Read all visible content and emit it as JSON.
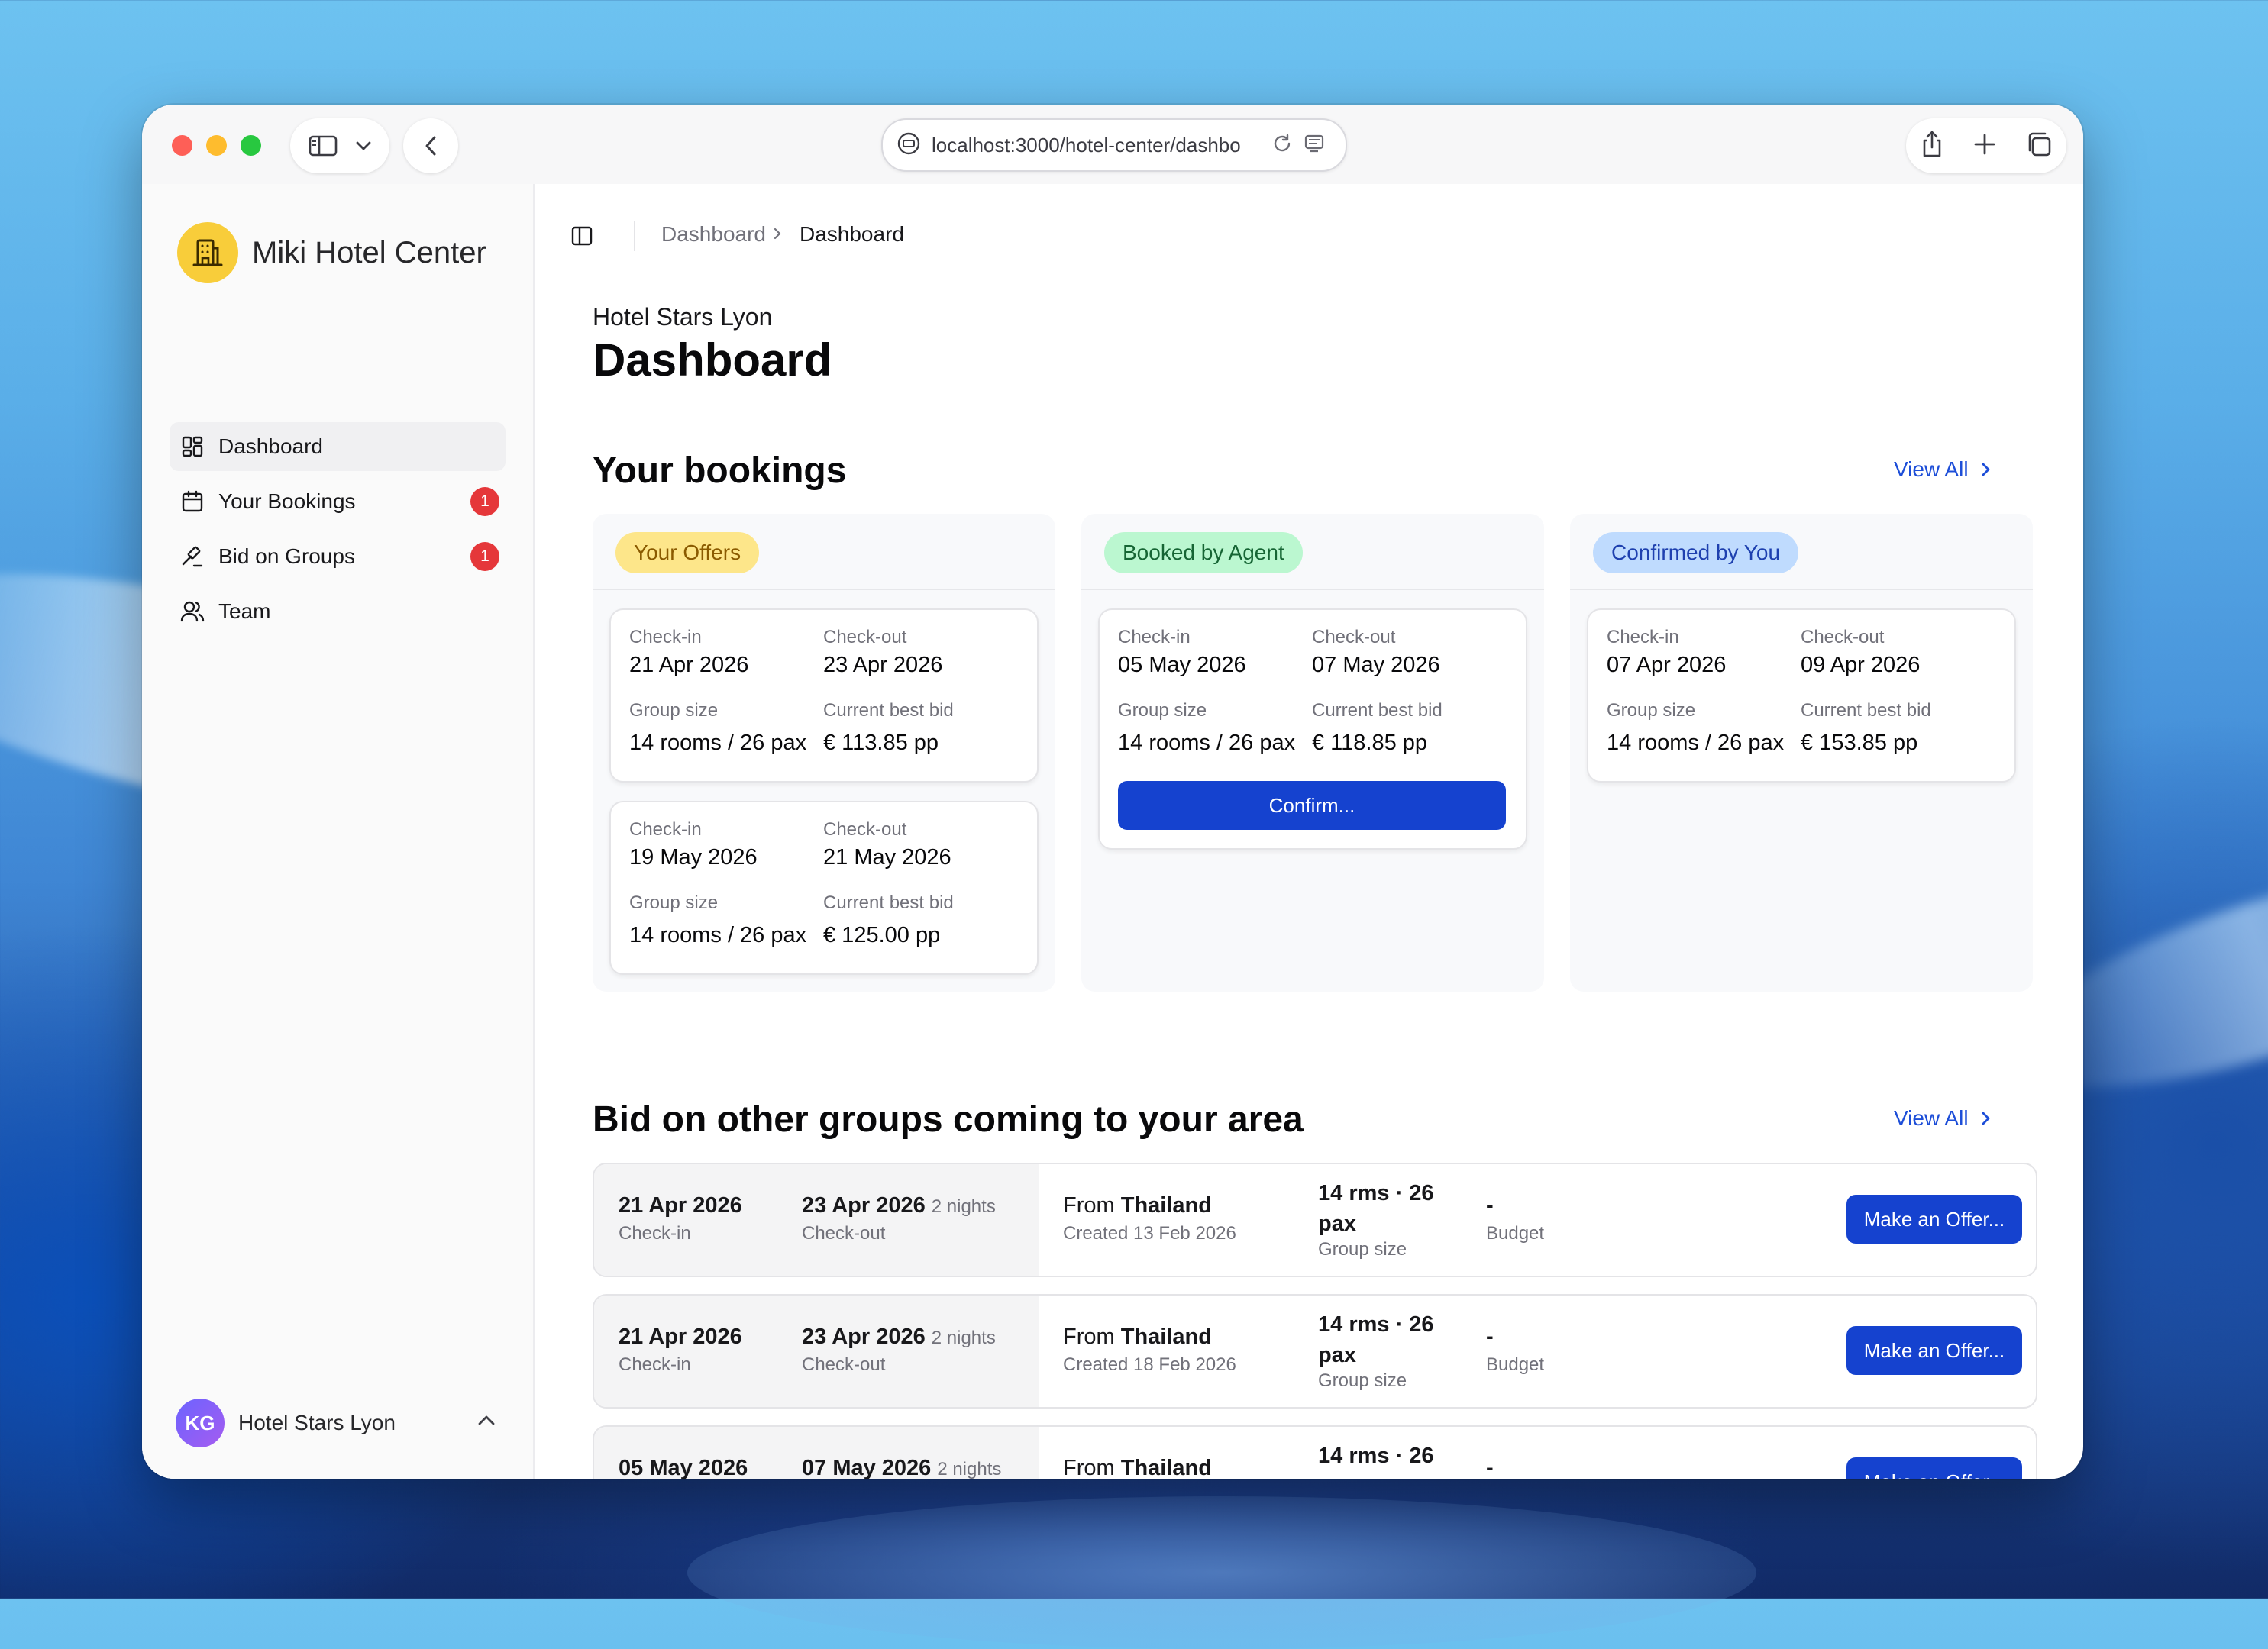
{
  "browser": {
    "url": "localhost:3000/hotel-center/dashbo"
  },
  "sidebar": {
    "brand": "Miki Hotel Center",
    "items": [
      {
        "label": "Dashboard",
        "icon": "dashboard-grid-icon",
        "active": true
      },
      {
        "label": "Your Bookings",
        "icon": "calendar-icon",
        "badge": "1"
      },
      {
        "label": "Bid on Groups",
        "icon": "gavel-icon",
        "badge": "1"
      },
      {
        "label": "Team",
        "icon": "users-icon"
      }
    ],
    "user": {
      "initials": "KG",
      "name": "Hotel Stars Lyon"
    }
  },
  "breadcrumb": {
    "parent": "Dashboard",
    "current": "Dashboard"
  },
  "header": {
    "hotel": "Hotel Stars Lyon",
    "title": "Dashboard"
  },
  "bookings": {
    "title": "Your bookings",
    "view_all": "View All",
    "labels": {
      "checkin": "Check-in",
      "checkout": "Check-out",
      "group_size": "Group size",
      "best_bid": "Current best bid"
    },
    "columns": [
      {
        "label": "Your Offers",
        "cards": [
          {
            "checkin": "21 Apr 2026",
            "checkout": "23 Apr 2026",
            "group": "14 rooms / 26 pax",
            "bid": "€ 113.85 pp"
          },
          {
            "checkin": "19 May 2026",
            "checkout": "21 May 2026",
            "group": "14 rooms / 26 pax",
            "bid": "€ 125.00 pp"
          }
        ]
      },
      {
        "label": "Booked by Agent",
        "cards": [
          {
            "checkin": "05 May 2026",
            "checkout": "07 May 2026",
            "group": "14 rooms / 26 pax",
            "bid": "€ 118.85 pp",
            "action": "Confirm..."
          }
        ]
      },
      {
        "label": "Confirmed by You",
        "cards": [
          {
            "checkin": "07 Apr 2026",
            "checkout": "09 Apr 2026",
            "group": "14 rooms / 26 pax",
            "bid": "€ 153.85 pp"
          }
        ]
      }
    ]
  },
  "groups": {
    "title": "Bid on other groups coming to your area",
    "view_all": "View All",
    "labels": {
      "checkin": "Check-in",
      "checkout": "Check-out",
      "from": "From",
      "group_size": "Group size",
      "budget": "Budget"
    },
    "rows": [
      {
        "checkin": "21 Apr 2026",
        "checkout": "23 Apr 2026",
        "nights": "2 nights",
        "country": "Thailand",
        "created": "Created 13 Feb 2026",
        "size": "14 rms · 26 pax",
        "budget": "-",
        "action": "Make an Offer..."
      },
      {
        "checkin": "21 Apr 2026",
        "checkout": "23 Apr 2026",
        "nights": "2 nights",
        "country": "Thailand",
        "created": "Created 18 Feb 2026",
        "size": "14 rms · 26 pax",
        "budget": "-",
        "action": "Make an Offer..."
      },
      {
        "checkin": "05 May 2026",
        "checkout": "07 May 2026",
        "nights": "2 nights",
        "country": "Thailand",
        "created": "",
        "size": "14 rms · 26",
        "budget": "-",
        "action": "Make an Offer..."
      }
    ]
  }
}
